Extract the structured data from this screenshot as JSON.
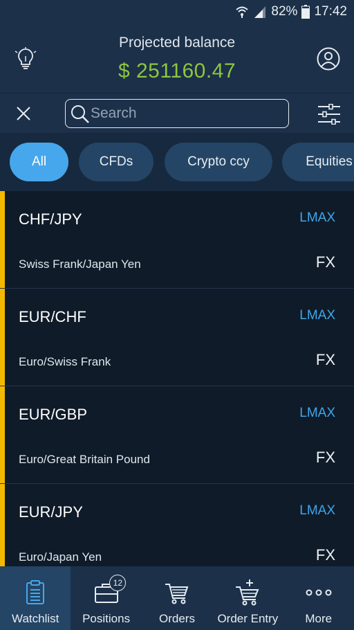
{
  "status_bar": {
    "battery": "82%",
    "time": "17:42"
  },
  "header": {
    "title": "Projected balance",
    "balance": "$ 251160.47"
  },
  "search": {
    "placeholder": "Search",
    "value": ""
  },
  "filters": [
    "All",
    "CFDs",
    "Crypto ccy",
    "Equities"
  ],
  "watchlist": [
    {
      "symbol": "CHF/JPY",
      "venue": "LMAX",
      "description": "Swiss Frank/Japan Yen",
      "asset_class": "FX"
    },
    {
      "symbol": "EUR/CHF",
      "venue": "LMAX",
      "description": "Euro/Swiss Frank",
      "asset_class": "FX"
    },
    {
      "symbol": "EUR/GBP",
      "venue": "LMAX",
      "description": "Euro/Great Britain Pound",
      "asset_class": "FX"
    },
    {
      "symbol": "EUR/JPY",
      "venue": "LMAX",
      "description": "Euro/Japan Yen",
      "asset_class": "FX"
    }
  ],
  "tabs": [
    {
      "label": "Watchlist",
      "icon": "clipboard-icon"
    },
    {
      "label": "Positions",
      "icon": "briefcase-icon",
      "badge": "12"
    },
    {
      "label": "Orders",
      "icon": "cart-icon"
    },
    {
      "label": "Order Entry",
      "icon": "cart-plus-icon"
    },
    {
      "label": "More",
      "icon": "more-dots-icon"
    }
  ],
  "colors": {
    "accent_blue": "#46a7ec",
    "balance_green": "#8dc63f",
    "row_accent": "#f5b800",
    "venue_blue": "#3fa7ea"
  }
}
